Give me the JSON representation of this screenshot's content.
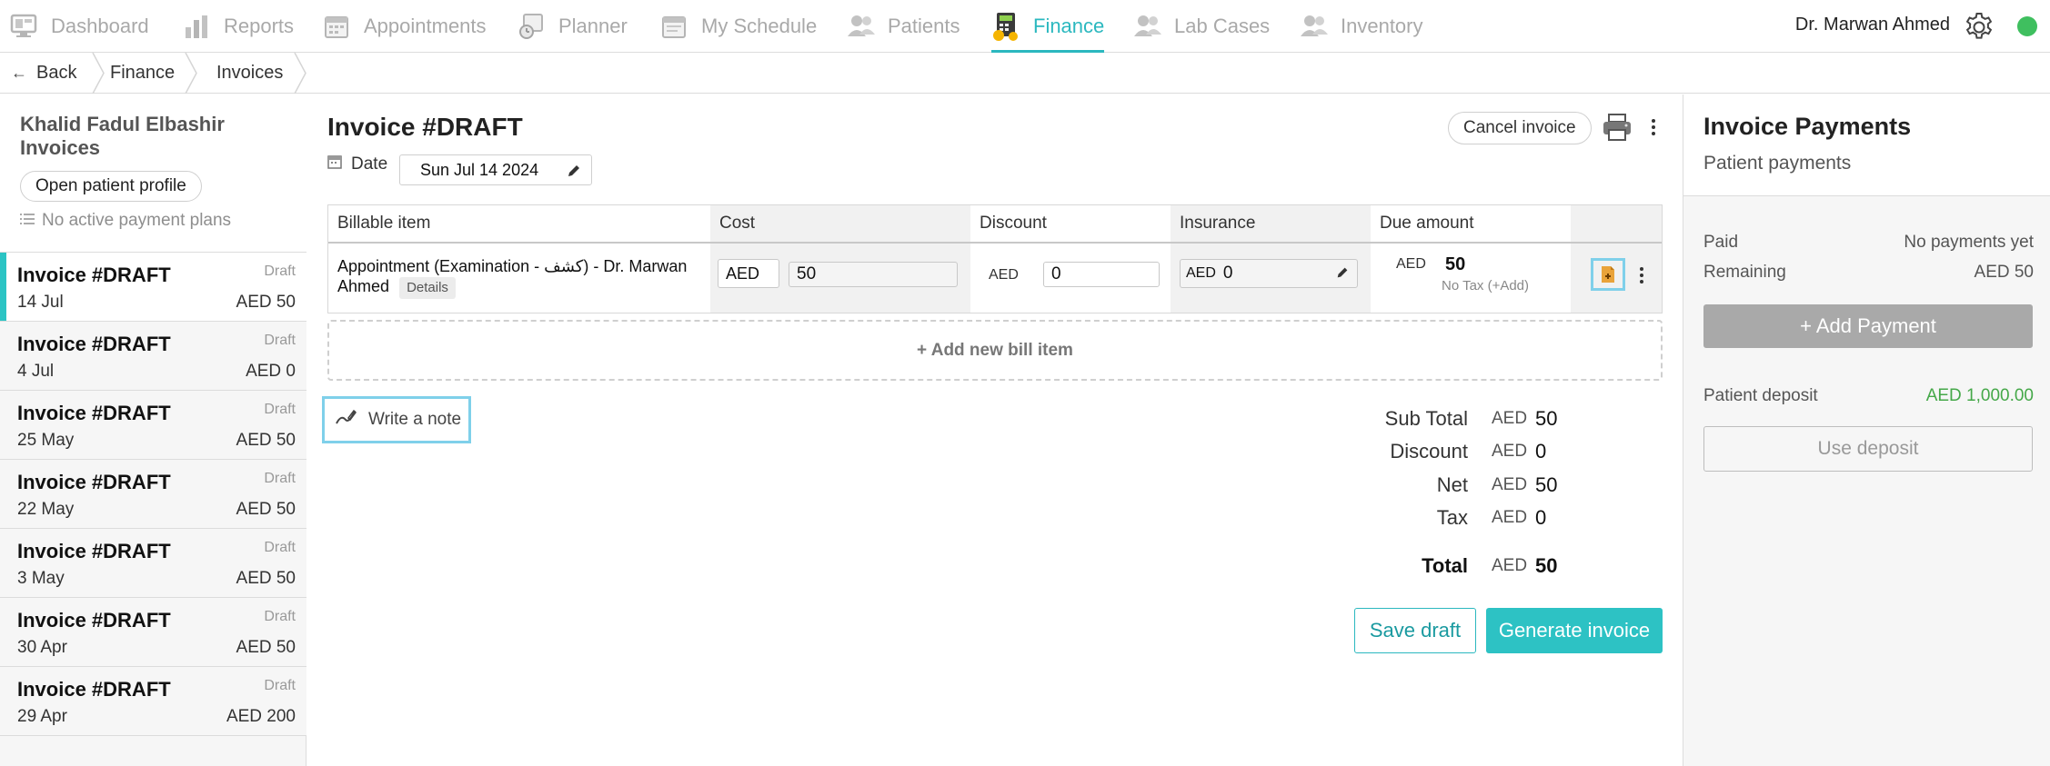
{
  "nav": {
    "items": [
      {
        "label": "Dashboard",
        "icon": "dashboard-icon"
      },
      {
        "label": "Reports",
        "icon": "reports-icon"
      },
      {
        "label": "Appointments",
        "icon": "appointments-icon"
      },
      {
        "label": "Planner",
        "icon": "planner-icon"
      },
      {
        "label": "My Schedule",
        "icon": "schedule-icon"
      },
      {
        "label": "Patients",
        "icon": "patients-icon"
      },
      {
        "label": "Finance",
        "icon": "finance-icon",
        "active": true
      },
      {
        "label": "Lab Cases",
        "icon": "lab-cases-icon"
      },
      {
        "label": "Inventory",
        "icon": "inventory-icon"
      }
    ],
    "user_name": "Dr. Marwan Ahmed",
    "accent_color": "#2bb8bf",
    "status_color": "#3fbf5f"
  },
  "breadcrumb": {
    "back": "Back",
    "items": [
      "Finance",
      "Invoices"
    ]
  },
  "sidebar": {
    "patient_title": "Khalid Fadul Elbashir Invoices",
    "open_profile": "Open patient profile",
    "no_plans": "No active payment plans",
    "invoices": [
      {
        "title": "Invoice #DRAFT",
        "status": "Draft",
        "date": "14 Jul",
        "amount": "AED 50",
        "selected": true
      },
      {
        "title": "Invoice #DRAFT",
        "status": "Draft",
        "date": "4 Jul",
        "amount": "AED 0"
      },
      {
        "title": "Invoice #DRAFT",
        "status": "Draft",
        "date": "25 May",
        "amount": "AED 50"
      },
      {
        "title": "Invoice #DRAFT",
        "status": "Draft",
        "date": "22 May",
        "amount": "AED 50"
      },
      {
        "title": "Invoice #DRAFT",
        "status": "Draft",
        "date": "3 May",
        "amount": "AED 50"
      },
      {
        "title": "Invoice #DRAFT",
        "status": "Draft",
        "date": "30 Apr",
        "amount": "AED 50"
      },
      {
        "title": "Invoice #DRAFT",
        "status": "Draft",
        "date": "29 Apr",
        "amount": "AED 200"
      }
    ]
  },
  "invoice": {
    "title": "Invoice #DRAFT",
    "cancel": "Cancel invoice",
    "date_label": "Date",
    "date_value": "Sun Jul 14 2024",
    "columns": [
      "Billable item",
      "Cost",
      "Discount",
      "Insurance",
      "Due amount"
    ],
    "row": {
      "item": "Appointment (Examination - كشف) - Dr. Marwan Ahmed",
      "details": "Details",
      "cost_currency": "AED",
      "cost": "50",
      "discount_currency": "AED",
      "discount": "0",
      "insurance_currency": "AED",
      "insurance": "0",
      "due_currency": "AED",
      "due": "50",
      "tax_note": "No Tax (+Add)"
    },
    "add_bill_item": "+ Add new bill item",
    "write_note": "Write a note",
    "totals": [
      {
        "label": "Sub Total",
        "currency": "AED",
        "value": "50"
      },
      {
        "label": "Discount",
        "currency": "AED",
        "value": "0"
      },
      {
        "label": "Net",
        "currency": "AED",
        "value": "50"
      },
      {
        "label": "Tax",
        "currency": "AED",
        "value": "0"
      },
      {
        "label": "Total",
        "currency": "AED",
        "value": "50",
        "bold": true
      }
    ],
    "save_draft": "Save draft",
    "generate": "Generate invoice"
  },
  "payments": {
    "title": "Invoice Payments",
    "subtitle": "Patient payments",
    "paid_label": "Paid",
    "paid_value": "No payments yet",
    "remaining_label": "Remaining",
    "remaining_value": "AED 50",
    "add_payment": "+ Add Payment",
    "deposit_label": "Patient deposit",
    "deposit_value": "AED 1,000.00",
    "use_deposit": "Use deposit"
  }
}
